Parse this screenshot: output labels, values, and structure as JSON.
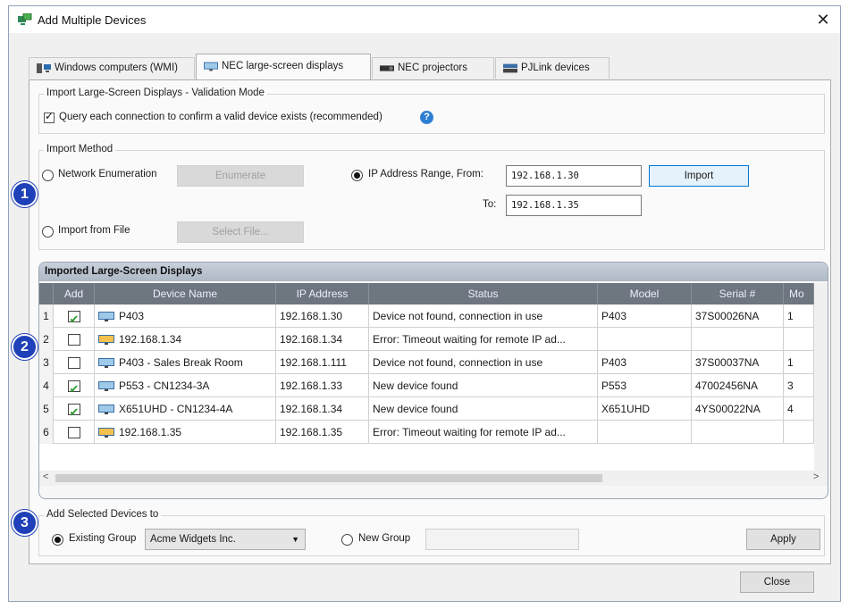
{
  "window": {
    "title": "Add Multiple Devices"
  },
  "tabs": [
    {
      "label": "Windows computers (WMI)"
    },
    {
      "label": "NEC large-screen displays"
    },
    {
      "label": "NEC projectors"
    },
    {
      "label": "PJLink devices"
    }
  ],
  "validation": {
    "group_label": "Import Large-Screen Displays - Validation Mode",
    "checkbox_label": "Query each connection to confirm a valid device exists (recommended)",
    "help_glyph": "?"
  },
  "import_method": {
    "group_label": "Import Method",
    "network_enum_label": "Network Enumeration",
    "enumerate_button": "Enumerate",
    "ip_range_label": "IP Address Range, From:",
    "ip_from": "192.168.1.30",
    "import_button": "Import",
    "to_label": "To:",
    "ip_to": "192.168.1.35",
    "import_file_label": "Import from File",
    "select_file_button": "Select File..."
  },
  "imported": {
    "panel_title": "Imported Large-Screen Displays",
    "columns": [
      "Add",
      "Device Name",
      "IP Address",
      "Status",
      "Model",
      "Serial #",
      "Mo"
    ],
    "rows": [
      {
        "n": "1",
        "add": true,
        "name": "P403",
        "ip": "192.168.1.30",
        "status": "Device not found, connection in use",
        "model": "P403",
        "serial": "37S00026NA",
        "mo": "1"
      },
      {
        "n": "2",
        "add": false,
        "name": "192.168.1.34",
        "ip": "192.168.1.34",
        "status": "Error: Timeout waiting for remote IP ad...",
        "model": "",
        "serial": "",
        "mo": ""
      },
      {
        "n": "3",
        "add": false,
        "name": "P403 - Sales Break Room",
        "ip": "192.168.1.111",
        "status": "Device not found, connection in use",
        "model": "P403",
        "serial": "37S00037NA",
        "mo": "1"
      },
      {
        "n": "4",
        "add": true,
        "name": "P553 - CN1234-3A",
        "ip": "192.168.1.33",
        "status": "New device found",
        "model": "P553",
        "serial": "47002456NA",
        "mo": "3"
      },
      {
        "n": "5",
        "add": true,
        "name": "X651UHD - CN1234-4A",
        "ip": "192.168.1.34",
        "status": "New device found",
        "model": "X651UHD",
        "serial": "4YS00022NA",
        "mo": "4"
      },
      {
        "n": "6",
        "add": false,
        "name": "192.168.1.35",
        "ip": "192.168.1.35",
        "status": "Error: Timeout waiting for remote IP ad...",
        "model": "",
        "serial": "",
        "mo": ""
      }
    ],
    "scroll_left": "<",
    "scroll_right": ">"
  },
  "add_selected": {
    "group_label": "Add Selected Devices to",
    "existing_group_label": "Existing Group",
    "existing_group_value": "Acme Widgets Inc.",
    "new_group_label": "New Group",
    "new_group_value": "",
    "apply_button": "Apply"
  },
  "footer": {
    "close_button": "Close"
  },
  "callouts": [
    "1",
    "2",
    "3"
  ],
  "colors": {
    "accent": "#1e40b8",
    "check_green": "#2a9a2a",
    "header_gray": "#6e7680"
  },
  "icons": [
    "app-devices-icon",
    "windows-computers-icon",
    "display-icon",
    "projector-icon",
    "pjlink-icon",
    "help-icon",
    "dropdown-arrow-icon"
  ]
}
